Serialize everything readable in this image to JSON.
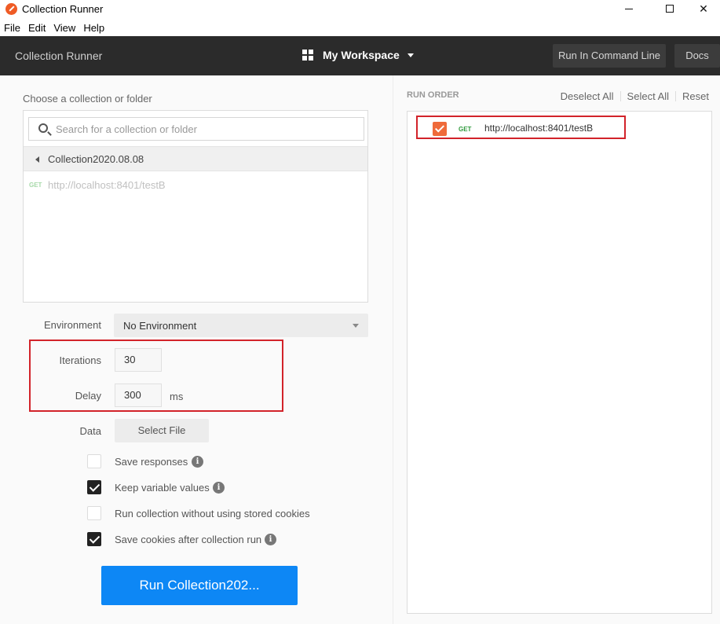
{
  "window": {
    "title": "Collection Runner"
  },
  "menu": [
    "File",
    "Edit",
    "View",
    "Help"
  ],
  "header": {
    "title": "Collection Runner",
    "workspace": "My Workspace",
    "run_cmd_label": "Run In Command Line",
    "docs_label": "Docs"
  },
  "left": {
    "choose_label": "Choose a collection or folder",
    "search_placeholder": "Search for a collection or folder",
    "collection_name": "Collection2020.08.08",
    "request": {
      "method": "GET",
      "url": "http://localhost:8401/testB"
    },
    "environment_label": "Environment",
    "environment_value": "No Environment",
    "iterations_label": "Iterations",
    "iterations_value": "30",
    "delay_label": "Delay",
    "delay_value": "300",
    "delay_unit": "ms",
    "data_label": "Data",
    "select_file_label": "Select File",
    "options": [
      {
        "label": "Save responses",
        "checked": false
      },
      {
        "label": "Keep variable values",
        "checked": true
      },
      {
        "label": "Run collection without using stored cookies",
        "checked": false
      },
      {
        "label": "Save cookies after collection run",
        "checked": true
      }
    ],
    "run_button": "Run Collection202..."
  },
  "right": {
    "run_order_label": "RUN ORDER",
    "deselect_all": "Deselect All",
    "select_all": "Select All",
    "reset": "Reset",
    "items": [
      {
        "method": "GET",
        "url": "http://localhost:8401/testB",
        "checked": true
      }
    ]
  },
  "colors": {
    "accent_blue": "#0d87f5",
    "header_bg": "#2b2b2b",
    "highlight_red": "#d2232a",
    "check_orange": "#ef6a3a",
    "get_green": "#2f9a3d"
  },
  "icons": {
    "app": "postman-icon",
    "search": "search-icon",
    "workspace": "grid-icon",
    "info": "info-icon"
  }
}
